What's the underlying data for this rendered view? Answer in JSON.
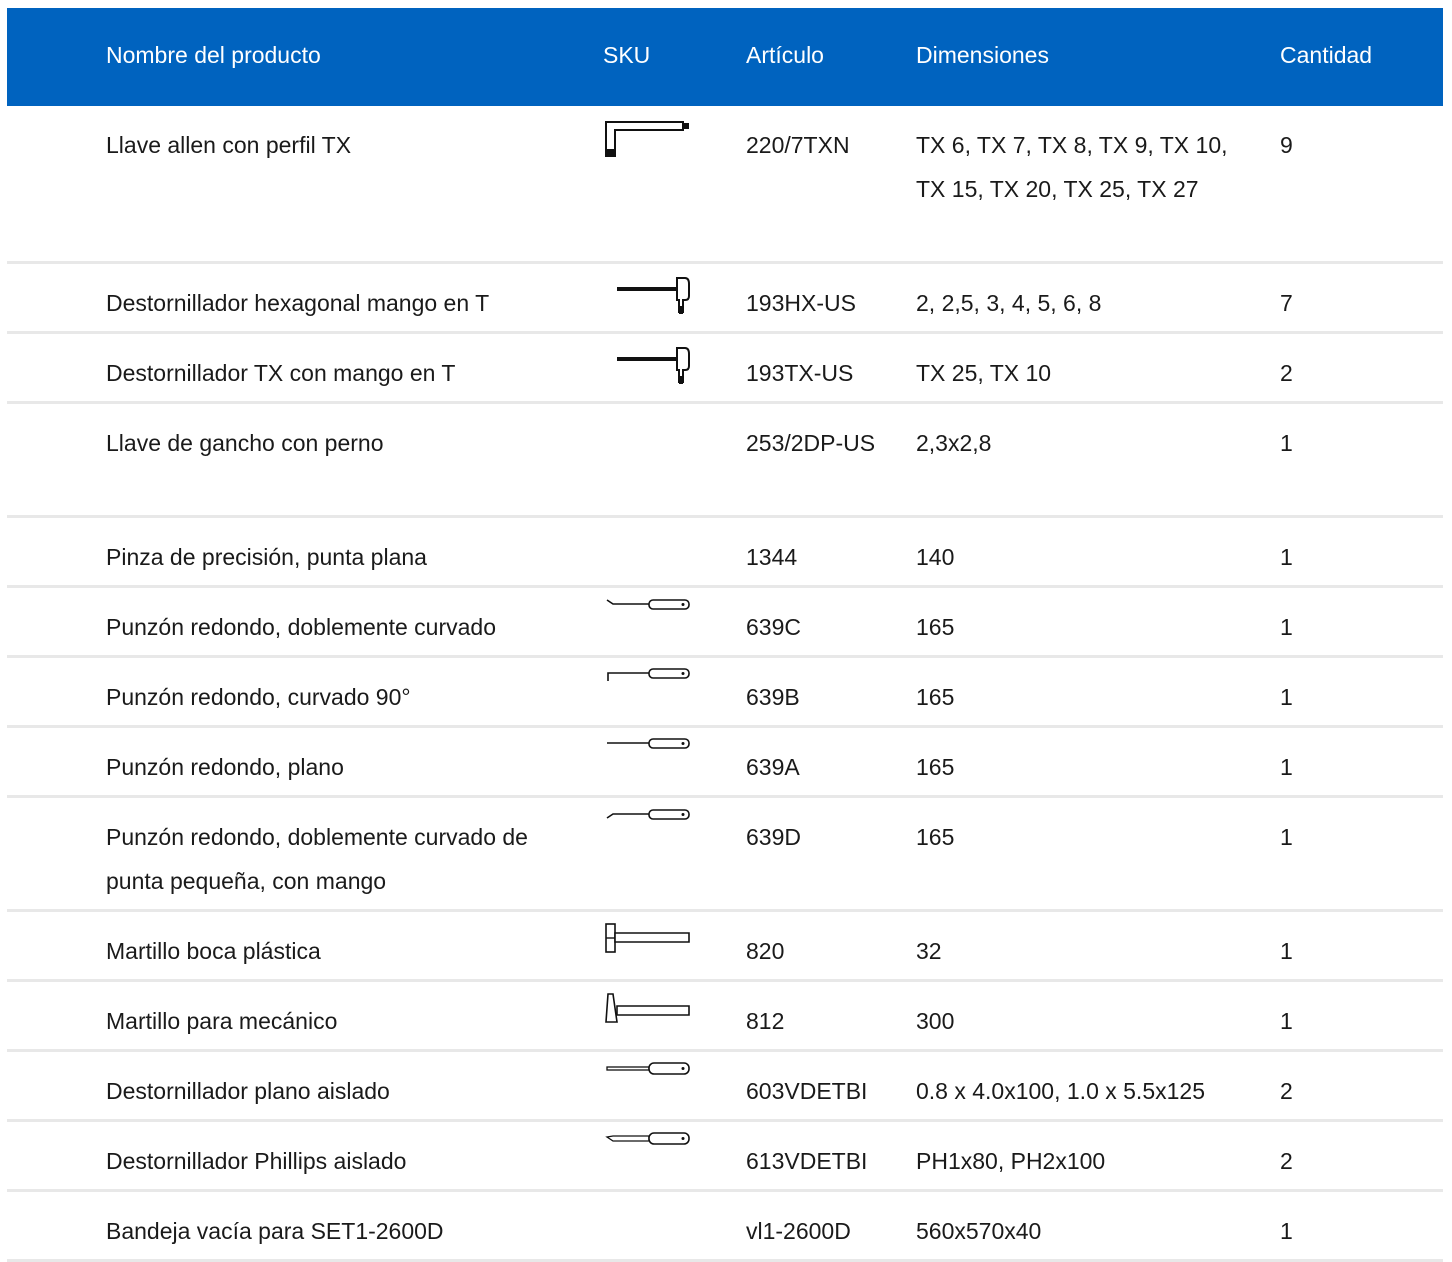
{
  "columns": [
    "Nombre del producto",
    "SKU",
    "Artículo",
    "Dimensiones",
    "Cantidad"
  ],
  "rows": [
    {
      "name": "Llave allen con perfil TX",
      "icon": "l-key-icon",
      "article": "220/7TXN",
      "dimensions": "TX 6, TX 7, TX 8, TX 9, TX 10, TX 15, TX 20, TX 25, TX 27",
      "qty": "9"
    },
    {
      "name": "Destornillador hexagonal mango en T",
      "icon": "t-handle-screwdriver-icon",
      "article": "193HX-US",
      "dimensions": "2, 2,5, 3, 4, 5, 6, 8",
      "qty": "7"
    },
    {
      "name": "Destornillador TX con mango en T",
      "icon": "t-handle-screwdriver-icon",
      "article": "193TX-US",
      "dimensions": "TX 25, TX 10",
      "qty": "2"
    },
    {
      "name": "Llave de gancho con perno",
      "icon": "",
      "article": "253/2DP-US",
      "dimensions": "2,3x2,8",
      "qty": "1"
    },
    {
      "name": "Pinza de precisión, punta plana",
      "icon": "",
      "article": "1344",
      "dimensions": "140",
      "qty": "1"
    },
    {
      "name": "Punzón redondo, doblemente curvado",
      "icon": "double-bent-pick-icon",
      "article": "639C",
      "dimensions": "165",
      "qty": "1"
    },
    {
      "name": "Punzón redondo, curvado 90°",
      "icon": "bent-90-pick-icon",
      "article": "639B",
      "dimensions": "165",
      "qty": "1"
    },
    {
      "name": "Punzón redondo, plano",
      "icon": "straight-pick-icon",
      "article": "639A",
      "dimensions": "165",
      "qty": "1"
    },
    {
      "name": "Punzón redondo, doblemente curvado de punta pequeña, con mango",
      "icon": "small-bent-pick-icon",
      "article": "639D",
      "dimensions": "165",
      "qty": "1"
    },
    {
      "name": "Martillo boca plástica",
      "icon": "plastic-mallet-icon",
      "article": "820",
      "dimensions": "32",
      "qty": "1"
    },
    {
      "name": "Martillo para mecánico",
      "icon": "machinist-hammer-icon",
      "article": "812",
      "dimensions": "300",
      "qty": "1"
    },
    {
      "name": "Destornillador plano aislado",
      "icon": "flat-screwdriver-icon",
      "article": "603VDETBI",
      "dimensions": "0.8 x 4.0x100, 1.0 x 5.5x125",
      "qty": "2"
    },
    {
      "name": "Destornillador Phillips aislado",
      "icon": "phillips-screwdriver-icon",
      "article": "613VDETBI",
      "dimensions": "PH1x80, PH2x100",
      "qty": "2"
    },
    {
      "name": "Bandeja vacía para SET1-2600D",
      "icon": "",
      "article": "vl1-2600D",
      "dimensions": "560x570x40",
      "qty": "1"
    }
  ]
}
